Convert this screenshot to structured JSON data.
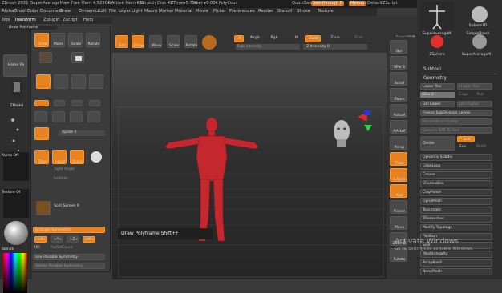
{
  "titlebar": {
    "app": "ZBrush 2021",
    "doc": "SuperAverageMan",
    "free_mem": "• Free Mem 4.523GB",
    "active_mem": "• Active Mem 612",
    "scratch": "• Scratch Disk 49",
    "ztime": "• ZTime▸5.796",
    "timer": "Timer ▸0.001",
    "polycount": "• PolyCour",
    "quicksave": "QuickSave",
    "seethrough": "See-through",
    "seethrough_val": "0",
    "menus": "Menus",
    "defaultzscript": "DefaultZScript"
  },
  "menu": [
    "Alpha",
    "Brush",
    "Color",
    "Document",
    "Draw",
    "Dynamics",
    "Edit",
    "File",
    "Layer",
    "Light",
    "Macro",
    "Marker",
    "Material",
    "Movie",
    "Picker",
    "Preferences",
    "Render",
    "Stencil",
    "Stroke",
    "Texture"
  ],
  "menu2": [
    "Tool",
    "Transform",
    "Zplugin",
    "Zscript",
    "Help"
  ],
  "flyout": {
    "header": "Draw Polyframe",
    "home": "Home Pa",
    "edit_row": [
      "Draw",
      "Move",
      "Scale",
      "Rotate"
    ],
    "xpose": "Xpose 0",
    "floor_label": "Floor",
    "local_label": "Local",
    "quick_label": "Quick",
    "tangle": "Tight Angle",
    "spotlight": "SetOrbi",
    "splitscreen": "Split Screen 0",
    "activate_symmetry": "Activate Symmetry",
    "sym_x": ">X<",
    "sym_y": ">Y<",
    "sym_z": ">Z<",
    "sym_m": ">M<",
    "radialcount": "RadialCount",
    "use_posable": "Use Posable Symmetry",
    "delete_posable": "Delete Posable Symmetry",
    "r_label": "(R)"
  },
  "left": {
    "zmodeler": "ZModel",
    "alpha_off": "Alpha Off",
    "texture_off": "Texture Of",
    "skin": "SkinSh"
  },
  "shelf": {
    "buttons": [
      "Edit",
      "Draw",
      "Move",
      "Scale",
      "Rotate"
    ],
    "a_btn": "A",
    "mrgb": "Mrgb",
    "rgb": "Rgb",
    "m_btn": "M",
    "zadd": "Zadd",
    "zsub": "Zsub",
    "zcut": "Zcut",
    "rgb_intensity": "Rgb Intensity",
    "z_intensity": "Z Intensity 0",
    "focal_shift": "Focal Shift"
  },
  "righttools": [
    "Bpr",
    "SPix 3",
    "Scroll",
    "Zoom",
    "Actual",
    "AAHalf",
    "Persp",
    "Floor",
    "L.Sym",
    "Xyz",
    "Frame",
    "Move",
    "ZoomD",
    "Rotate"
  ],
  "rightpanel": {
    "tools": [
      "Sphere3D",
      "SuperAverageM",
      "SimpleBrush",
      "ZSphere",
      "SuperAverageM"
    ],
    "subtool": "Subtool",
    "geometry": "Geometry",
    "lower_res": "Lower Res",
    "higher_res": "Higher Res",
    "sdiv": "SDiv 2",
    "cage": "Cage",
    "rstr": "Rstr",
    "del_lower": "Del Lower",
    "del_higher": "Del Higher",
    "freeze": "Freeze SubDivision Levels",
    "reconstruct": "Reconstruct Subdiv",
    "convert": "Convert BPR To Geo",
    "divide": "Divide",
    "smt": "Smt",
    "suv": "Suv",
    "reuv": "ReUV",
    "items": [
      "Dynamic Subdiv",
      "EdgeLoop",
      "Crease",
      "ShadowBox",
      "ClayPolish",
      "DynaMesh",
      "Tessimate",
      "ZRemesher",
      "Modify Topology",
      "Position",
      "Size",
      "MeshIntegrity",
      "ArrayMesh",
      "NanoMesh"
    ]
  },
  "tooltip": "Draw Polyframe Shift+F",
  "watermark": {
    "title": "Activate Windows",
    "subtitle": "Go to Settings to activate Windows."
  },
  "colors": {
    "accent": "#e8821f",
    "model": "#c4272d",
    "gizmo_red": "#e52424",
    "gizmo_green": "#2fd33a",
    "gizmo_blue": "#2436e0"
  }
}
